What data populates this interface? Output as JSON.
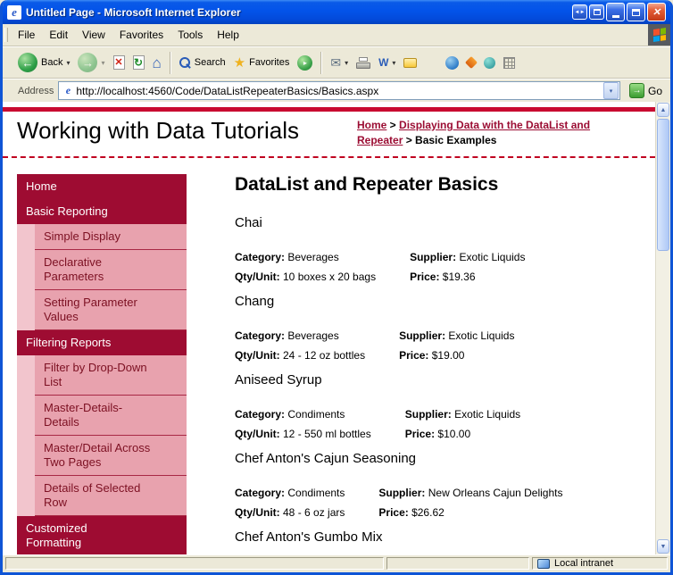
{
  "colors": {
    "titlebar_blue": "#0353E9",
    "accent_dark_red": "#9E0C32",
    "nav_sub_pink": "#E8A2AE",
    "nav_gutter_pink": "#F2C5CD",
    "header_rule_red": "#C90A30",
    "link_red": "#9B0D33",
    "chrome_tan": "#ECE9D8"
  },
  "window": {
    "title": "Untitled Page - Microsoft Internet Explorer",
    "status_zone": "Local intranet"
  },
  "menu": {
    "items": [
      "File",
      "Edit",
      "View",
      "Favorites",
      "Tools",
      "Help"
    ]
  },
  "toolbar": {
    "back": "Back",
    "search": "Search",
    "favorites": "Favorites"
  },
  "address": {
    "label": "Address",
    "url": "http://localhost:4560/Code/DataListRepeaterBasics/Basics.aspx",
    "go": "Go"
  },
  "icons": {
    "ie_logo": "e",
    "titlebar_arrows": "◄►",
    "close": "✕",
    "back_arrow": "←",
    "forward_arrow": "→",
    "stop": "✕",
    "refresh": "↻",
    "home": "⌂",
    "favorites_star": "★",
    "media_play": "▸",
    "mail": "✉",
    "edit_w": "W",
    "dropdown": "▾",
    "go_arrow": "→",
    "scroll_up": "▲",
    "scroll_down": "▼"
  },
  "page": {
    "site_title": "Working with Data Tutorials",
    "breadcrumb": {
      "home": "Home",
      "sep": " > ",
      "section": "Displaying Data with the DataList and Repeater",
      "current": "Basic Examples"
    },
    "heading": "DataList and Repeater Basics",
    "nav": [
      {
        "label": "Home",
        "type": "header"
      },
      {
        "label": "Basic Reporting",
        "type": "header"
      },
      {
        "label": "Simple Display",
        "type": "sub"
      },
      {
        "label": "Declarative Parameters",
        "type": "sub"
      },
      {
        "label": "Setting Parameter Values",
        "type": "sub"
      },
      {
        "label": "Filtering Reports",
        "type": "header"
      },
      {
        "label": "Filter by Drop-Down List",
        "type": "sub"
      },
      {
        "label": "Master-Details-Details",
        "type": "sub"
      },
      {
        "label": "Master/Detail Across Two Pages",
        "type": "sub"
      },
      {
        "label": "Details of Selected Row",
        "type": "sub"
      },
      {
        "label": "Customized Formatting",
        "type": "header"
      }
    ],
    "labels": {
      "category": "Category:",
      "supplier": "Supplier:",
      "qty": "Qty/Unit:",
      "price": "Price:"
    },
    "products": [
      {
        "name": "Chai",
        "category": "Beverages",
        "supplier": "Exotic Liquids",
        "qty": "10 boxes x 20 bags",
        "price": "$19.36"
      },
      {
        "name": "Chang",
        "category": "Beverages",
        "supplier": "Exotic Liquids",
        "qty": "24 - 12 oz bottles",
        "price": "$19.00"
      },
      {
        "name": "Aniseed Syrup",
        "category": "Condiments",
        "supplier": "Exotic Liquids",
        "qty": "12 - 550 ml bottles",
        "price": "$10.00"
      },
      {
        "name": "Chef Anton's Cajun Seasoning",
        "category": "Condiments",
        "supplier": "New Orleans Cajun Delights",
        "qty": "48 - 6 oz jars",
        "price": "$26.62"
      },
      {
        "name": "Chef Anton's Gumbo Mix"
      }
    ]
  }
}
